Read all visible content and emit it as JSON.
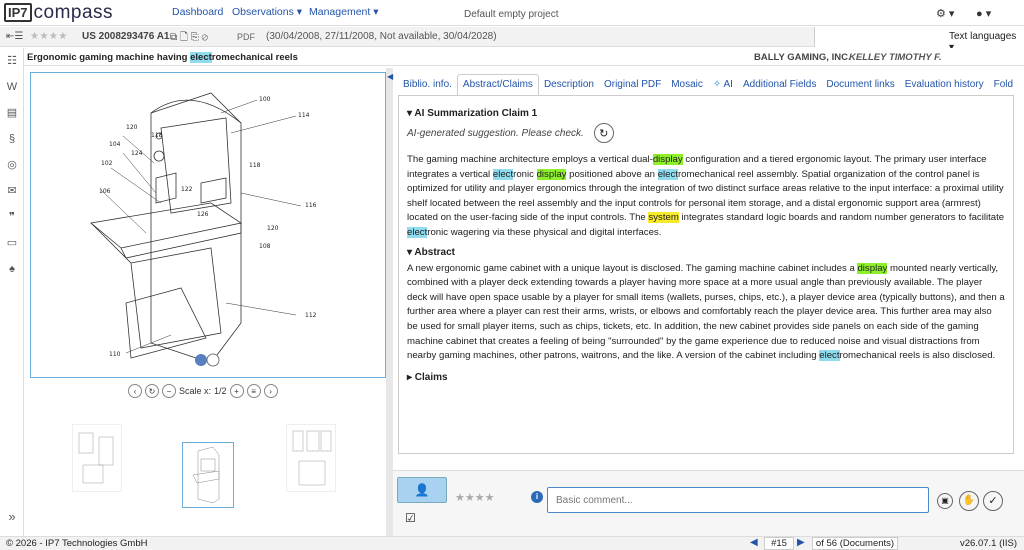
{
  "app": {
    "logo_box": "IP7",
    "logo_name": "compass",
    "project": "Default empty project"
  },
  "nav": {
    "dashboard": "Dashboard",
    "observations": "Observations ▾",
    "management": "Management ▾"
  },
  "top_icons": {
    "gear": "⚙ ▾",
    "user": "● ▾"
  },
  "patent": {
    "stars": "★★★★",
    "number": "US 2008293476 A1",
    "doc_icons": "⧉ 🗋 ⎘ ⊘",
    "pdf": "PDF",
    "dates": "(30/04/2008, 27/11/2008, Not available, 30/04/2028)",
    "title_pre": "Ergonomic gaming machine having ",
    "title_hl": "elect",
    "title_post": "romechanical reels",
    "applicant": "BALLY GAMING, INC.",
    "inventor": "KELLEY TIMOTHY F."
  },
  "text_languages": "Text languages ▾",
  "rail_icons": [
    "⇤",
    "☷",
    "W",
    "▤",
    "§",
    "◎",
    "✉",
    "❞",
    "▭",
    "♠"
  ],
  "drawing": {
    "labels": [
      "100",
      "114",
      "120",
      "118",
      "104",
      "124",
      "102",
      "122",
      "106",
      "126",
      "118",
      "116",
      "120",
      "108",
      "112",
      "110"
    ],
    "scale_label": "Scale x:",
    "page": "1/2"
  },
  "tabs": [
    "Biblio. info.",
    "Abstract/Claims",
    "Description",
    "Original PDF",
    "Mosaic",
    "AI",
    "Additional Fields",
    "Document links",
    "Evaluation history",
    "Fold"
  ],
  "ai_section": {
    "heading": "▾ AI Summarization Claim 1",
    "suggestion": "AI-generated suggestion. Please check.",
    "p1a": "The gaming machine architecture employs a vertical dual-",
    "p1b": "display",
    "p1c": " configuration and a tiered ergonomic layout. The primary user interface integrates a vertical ",
    "p1d": "elect",
    "p1e": "ronic ",
    "p1f": "display",
    "p1g": " positioned above an ",
    "p1h": "elect",
    "p1i": "romechanical reel assembly. Spatial organization of the control panel is optimized for utility and player ergonomics through the integration of two distinct surface areas relative to the input interface: a proximal utility shelf located between the reel assembly and the input controls for personal item storage, and a distal ergonomic support area (armrest) located on the user-facing side of the input controls. The ",
    "p1j": "system",
    "p1k": " integrates standard logic boards and random number generators to facilitate ",
    "p1l": "elect",
    "p1m": "ronic wagering via these physical and digital interfaces."
  },
  "abstract": {
    "heading": "▾ Abstract",
    "a1": "A new ergonomic game cabinet with a unique layout is disclosed. The gaming machine cabinet includes a ",
    "a2": "display",
    "a3": " mounted nearly vertically, combined with a player deck extending towards a player having more space at a more usual angle than previously available. The player deck will have open space usable by a player for small items (wallets, purses, chips, etc.), a player device area (typically buttons), and then a further area where a player can rest their arms, wrists, or elbows and comfortably reach the player device area. This further area may also be used for small player items, such as chips, tickets, etc. In addition, the new cabinet provides side panels on each side of the gaming machine cabinet that creates a feeling of being \"surrounded\" by the game experience due to reduced noise and visual distractions from nearby gaming machines, other patrons, waitrons, and the like. A version of the cabinet including ",
    "a4": "elect",
    "a5": "romechanical reels is also disclosed."
  },
  "claims_heading": "▸ Claims",
  "comment": {
    "stars": "★★★★",
    "placeholder": "Basic comment...",
    "info": "i"
  },
  "footer": {
    "copyright": "© 2026 - IP7 Technologies GmbH",
    "position": "#15",
    "of_docs": "of 56 (Documents)",
    "version": "v26.07.1 (IIS)"
  },
  "colors": {
    "accent": "#2255aa",
    "frame": "#6aaedc",
    "highlight_blue": "#8fdcef",
    "highlight_green": "#8ef02a",
    "highlight_yellow": "#f7ea2a"
  }
}
